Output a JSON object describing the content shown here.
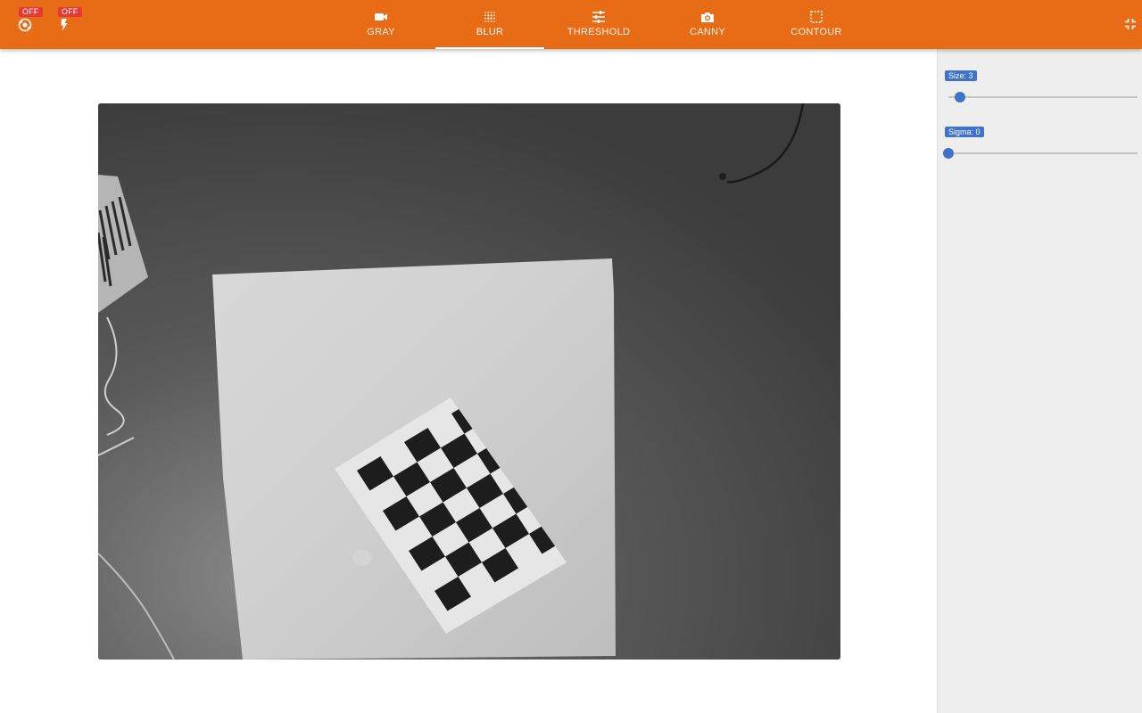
{
  "toolbar": {
    "camera_toggle": {
      "state": "OFF",
      "icon": "camera-switch-icon"
    },
    "flash_toggle": {
      "state": "OFF",
      "icon": "flash-icon"
    },
    "tabs": [
      {
        "label": "GRAY",
        "icon": "videocam-icon",
        "active": false
      },
      {
        "label": "BLUR",
        "icon": "blur-icon",
        "active": true
      },
      {
        "label": "THRESHOLD",
        "icon": "tune-icon",
        "active": false
      },
      {
        "label": "CANNY",
        "icon": "camera-icon",
        "active": false
      },
      {
        "label": "CONTOUR",
        "icon": "select-region-icon",
        "active": false
      }
    ],
    "fullscreen_icon": "fullscreen-exit-icon"
  },
  "sidebar": {
    "sliders": [
      {
        "label": "Size: 3",
        "name": "Size",
        "value": 3,
        "position": 0.0
      },
      {
        "label": "Sigma: 0",
        "name": "Sigma",
        "value": 0,
        "position": 0.0
      }
    ]
  },
  "colors": {
    "accent": "#e86b16",
    "badge_off": "#e53935",
    "slider": "#3f72c9",
    "sidebar_bg": "#eeeeee"
  }
}
